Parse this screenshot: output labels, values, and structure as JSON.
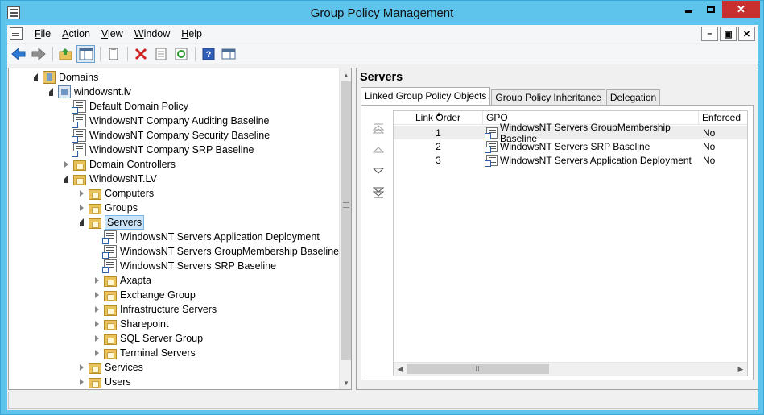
{
  "window": {
    "title": "Group Policy Management",
    "controls": {
      "minimize": "minimize",
      "maximize": "maximize",
      "close": "✕"
    }
  },
  "menu": {
    "items": [
      {
        "label": "File",
        "accel": "F",
        "rest": "ile"
      },
      {
        "label": "Action",
        "accel": "A",
        "rest": "ction"
      },
      {
        "label": "View",
        "accel": "V",
        "rest": "iew"
      },
      {
        "label": "Window",
        "accel": "W",
        "rest": "indow"
      },
      {
        "label": "Help",
        "accel": "H",
        "rest": "elp"
      }
    ]
  },
  "toolbar": {
    "buttons": [
      "back-arrow-icon",
      "forward-arrow-icon",
      "up-folder-icon",
      "show-hide-tree-icon",
      "properties-icon",
      "delete-icon",
      "export-list-icon",
      "refresh-icon",
      "help-icon",
      "action-pane-icon"
    ]
  },
  "tree": {
    "items": [
      {
        "label": "Domains",
        "level": 0,
        "state": "expanded",
        "icon": "domains-icon"
      },
      {
        "label": "windowsnt.lv",
        "level": 1,
        "state": "expanded",
        "icon": "domain-icon"
      },
      {
        "label": "Default Domain Policy",
        "level": 2,
        "state": "none",
        "icon": "gpo-link-icon"
      },
      {
        "label": "WindowsNT Company Auditing Baseline",
        "level": 2,
        "state": "none",
        "icon": "gpo-link-icon"
      },
      {
        "label": "WindowsNT Company Security Baseline",
        "level": 2,
        "state": "none",
        "icon": "gpo-link-icon"
      },
      {
        "label": "WindowsNT Company SRP Baseline",
        "level": 2,
        "state": "none",
        "icon": "gpo-link-icon"
      },
      {
        "label": "Domain Controllers",
        "level": 2,
        "state": "collapsed",
        "icon": "ou-folder-icon"
      },
      {
        "label": "WindowsNT.LV",
        "level": 2,
        "state": "expanded",
        "icon": "ou-folder-icon"
      },
      {
        "label": "Computers",
        "level": 3,
        "state": "collapsed",
        "icon": "ou-folder-icon"
      },
      {
        "label": "Groups",
        "level": 3,
        "state": "collapsed",
        "icon": "ou-folder-icon"
      },
      {
        "label": "Servers",
        "level": 3,
        "state": "expanded",
        "icon": "ou-folder-icon",
        "selected": true
      },
      {
        "label": "WindowsNT Servers Application Deployment",
        "level": 4,
        "state": "none",
        "icon": "gpo-link-icon"
      },
      {
        "label": "WindowsNT Servers GroupMembership Baseline",
        "level": 4,
        "state": "none",
        "icon": "gpo-link-icon"
      },
      {
        "label": "WindowsNT Servers SRP Baseline",
        "level": 4,
        "state": "none",
        "icon": "gpo-link-icon"
      },
      {
        "label": "Axapta",
        "level": 4,
        "state": "collapsed",
        "icon": "ou-folder-icon"
      },
      {
        "label": "Exchange Group",
        "level": 4,
        "state": "collapsed",
        "icon": "ou-folder-icon"
      },
      {
        "label": "Infrastructure Servers",
        "level": 4,
        "state": "collapsed",
        "icon": "ou-folder-icon"
      },
      {
        "label": "Sharepoint",
        "level": 4,
        "state": "collapsed",
        "icon": "ou-folder-icon"
      },
      {
        "label": "SQL Server Group",
        "level": 4,
        "state": "collapsed",
        "icon": "ou-folder-icon"
      },
      {
        "label": "Terminal Servers",
        "level": 4,
        "state": "collapsed",
        "icon": "ou-folder-icon"
      },
      {
        "label": "Services",
        "level": 3,
        "state": "collapsed",
        "icon": "ou-folder-icon"
      },
      {
        "label": "Users",
        "level": 3,
        "state": "collapsed",
        "icon": "ou-folder-icon"
      }
    ]
  },
  "detail": {
    "title": "Servers",
    "tabs": [
      {
        "label": "Linked Group Policy Objects",
        "active": true
      },
      {
        "label": "Group Policy Inheritance",
        "active": false
      },
      {
        "label": "Delegation",
        "active": false
      }
    ],
    "columns": [
      "Link Order",
      "GPO",
      "Enforced"
    ],
    "rows": [
      {
        "order": "1",
        "gpo": "WindowsNT Servers GroupMembership Baseline",
        "enforced": "No",
        "selected": true
      },
      {
        "order": "2",
        "gpo": "WindowsNT Servers SRP Baseline",
        "enforced": "No",
        "selected": false
      },
      {
        "order": "3",
        "gpo": "WindowsNT Servers Application Deployment",
        "enforced": "No",
        "selected": false
      }
    ]
  }
}
